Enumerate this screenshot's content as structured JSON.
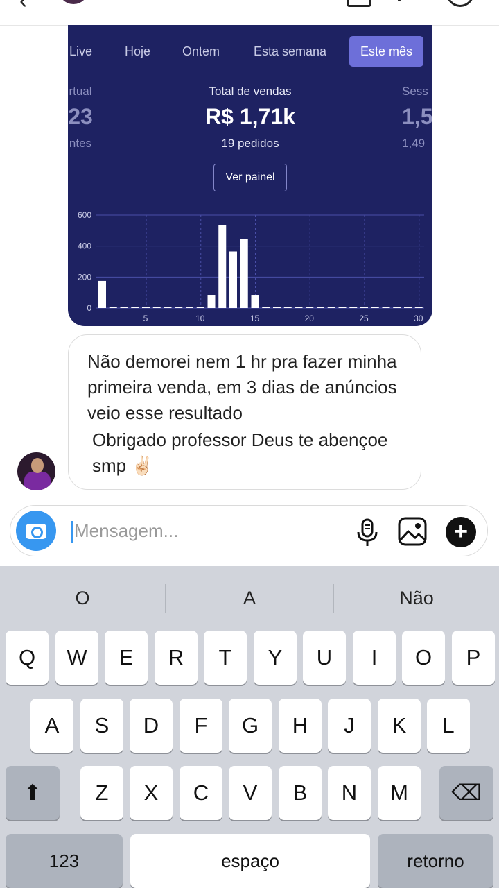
{
  "chart_card": {
    "tabs": [
      "Live",
      "Hoje",
      "Ontem",
      "Esta semana",
      "Este mês"
    ],
    "active_tab": "Este mês",
    "left_stat": {
      "label": "rtual",
      "value": "23",
      "sub": "ntes"
    },
    "center_stat": {
      "label": "Total de vendas",
      "value": "R$ 1,71k",
      "sub": "19 pedidos"
    },
    "right_stat": {
      "label": "Sess",
      "value": "1,5",
      "sub": "1,49"
    },
    "button_label": "Ver painel",
    "colors": {
      "background": "#1e2262",
      "bars": "#ffffff",
      "active_tab": "#6d6fd9"
    }
  },
  "chart_data": {
    "type": "bar",
    "x": [
      1,
      2,
      3,
      4,
      5,
      6,
      7,
      8,
      9,
      10,
      11,
      12,
      13,
      14,
      15,
      16,
      17,
      18,
      19,
      20,
      21,
      22,
      23,
      24,
      25,
      26,
      27,
      28,
      29,
      30
    ],
    "values": [
      175,
      6,
      6,
      6,
      6,
      6,
      6,
      6,
      6,
      6,
      85,
      535,
      365,
      445,
      85,
      6,
      6,
      6,
      6,
      6,
      6,
      6,
      6,
      6,
      6,
      6,
      6,
      6,
      6,
      6
    ],
    "xticks": [
      "5",
      "10",
      "15",
      "20",
      "25",
      "30"
    ],
    "yticks": [
      "0",
      "200",
      "400",
      "600"
    ],
    "ylim": [
      0,
      600
    ],
    "grid": true
  },
  "message": {
    "line1": "Não demorei nem 1 hr pra fazer minha primeira venda, em 3 dias de anúncios veio esse resultado",
    "line2": "Obrigado professor Deus te abençoe smp ✌🏻"
  },
  "composer": {
    "placeholder": "Mensagem...",
    "value": ""
  },
  "keyboard": {
    "suggestions": [
      "O",
      "A",
      "Não"
    ],
    "row1": [
      "Q",
      "W",
      "E",
      "R",
      "T",
      "Y",
      "U",
      "I",
      "O",
      "P"
    ],
    "row2": [
      "A",
      "S",
      "D",
      "F",
      "G",
      "H",
      "J",
      "K",
      "L"
    ],
    "row3": [
      "Z",
      "X",
      "C",
      "V",
      "B",
      "N",
      "M"
    ],
    "shift": "⬆",
    "backspace": "⌫",
    "numbers": "123",
    "space": "espaço",
    "return": "retorno"
  }
}
